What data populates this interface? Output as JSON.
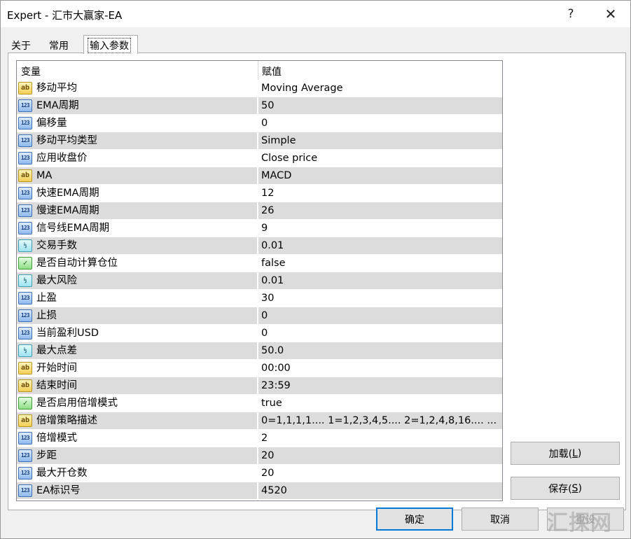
{
  "window": {
    "title": "Expert - 汇市大赢家-EA",
    "help_glyph": "?",
    "close_glyph": "✕"
  },
  "tabs": [
    {
      "label": "关于"
    },
    {
      "label": "常用"
    },
    {
      "label": "输入参数"
    }
  ],
  "grid": {
    "headers": {
      "variable": "变量",
      "value": "赋值"
    },
    "rows": [
      {
        "icon": "text-type-icon",
        "badge": "ab",
        "name": "移动平均",
        "value": "Moving Average"
      },
      {
        "icon": "integer-type-icon",
        "badge": "123",
        "name": "EMA周期",
        "value": "50"
      },
      {
        "icon": "integer-type-icon",
        "badge": "123",
        "name": "偏移量",
        "value": "0"
      },
      {
        "icon": "integer-type-icon",
        "badge": "123",
        "name": "移动平均类型",
        "value": "Simple"
      },
      {
        "icon": "integer-type-icon",
        "badge": "123",
        "name": "应用收盘价",
        "value": "Close price"
      },
      {
        "icon": "text-type-icon",
        "badge": "ab",
        "name": "MA",
        "value": "MACD"
      },
      {
        "icon": "integer-type-icon",
        "badge": "123",
        "name": "快速EMA周期",
        "value": "12"
      },
      {
        "icon": "integer-type-icon",
        "badge": "123",
        "name": "慢速EMA周期",
        "value": "26"
      },
      {
        "icon": "integer-type-icon",
        "badge": "123",
        "name": "信号线EMA周期",
        "value": "9"
      },
      {
        "icon": "double-type-icon",
        "badge": "½",
        "name": "交易手数",
        "value": "0.01"
      },
      {
        "icon": "bool-type-icon",
        "badge": "✓",
        "name": "是否自动计算仓位",
        "value": "false"
      },
      {
        "icon": "double-type-icon",
        "badge": "½",
        "name": "最大风险",
        "value": "0.01"
      },
      {
        "icon": "integer-type-icon",
        "badge": "123",
        "name": "止盈",
        "value": "30"
      },
      {
        "icon": "integer-type-icon",
        "badge": "123",
        "name": "止损",
        "value": "0"
      },
      {
        "icon": "integer-type-icon",
        "badge": "123",
        "name": "当前盈利USD",
        "value": "0"
      },
      {
        "icon": "double-type-icon",
        "badge": "½",
        "name": "最大点差",
        "value": "50.0"
      },
      {
        "icon": "text-type-icon",
        "badge": "ab",
        "name": "开始时间",
        "value": "00:00"
      },
      {
        "icon": "text-type-icon",
        "badge": "ab",
        "name": "结束时间",
        "value": "23:59"
      },
      {
        "icon": "bool-type-icon",
        "badge": "✓",
        "name": "是否启用倍增模式",
        "value": "true"
      },
      {
        "icon": "text-type-icon",
        "badge": "ab",
        "name": "倍增策略描述",
        "value": "0=1,1,1,1....    1=1,2,3,4,5....    2=1,2,4,8,16.... ..."
      },
      {
        "icon": "integer-type-icon",
        "badge": "123",
        "name": "倍增模式",
        "value": "2"
      },
      {
        "icon": "integer-type-icon",
        "badge": "123",
        "name": "步距",
        "value": "20"
      },
      {
        "icon": "integer-type-icon",
        "badge": "123",
        "name": "最大开仓数",
        "value": "20"
      },
      {
        "icon": "integer-type-icon",
        "badge": "123",
        "name": "EA标识号",
        "value": "4520"
      }
    ]
  },
  "side_buttons": {
    "load": {
      "label": "加载(",
      "key": "L",
      "suffix": ")"
    },
    "save": {
      "label": "保存(",
      "key": "S",
      "suffix": ")"
    }
  },
  "footer_buttons": {
    "ok": "确定",
    "cancel": "取消",
    "reset": "重设"
  },
  "watermark": "汇探网"
}
